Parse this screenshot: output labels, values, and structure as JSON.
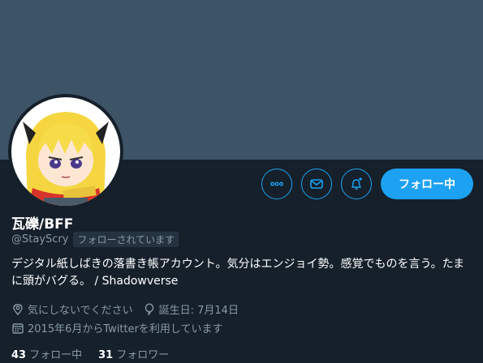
{
  "profile": {
    "display_name": "瓦礫/BFF",
    "handle": "@StayScry",
    "follows_you_badge": "フォローされています",
    "bio": "デジタル紙しばきの落書き帳アカウント。気分はエンジョイ勢。感覚でものを言う。たまに頭がバグる。 / Shadowverse",
    "location": "気にしないでください",
    "birthday": "誕生日: 7月14日",
    "joined": "2015年6月からTwitterを利用しています"
  },
  "actions": {
    "more_icon": "more-dots-icon",
    "message_icon": "envelope-icon",
    "notify_icon": "bell-plus-icon",
    "follow_label": "フォロー中"
  },
  "stats": {
    "following_count": "43",
    "following_label": "フォロー中",
    "followers_count": "31",
    "followers_label": "フォロワー"
  },
  "colors": {
    "background": "#15202b",
    "banner": "#3d5466",
    "accent": "#1da1f2",
    "secondary_text": "#8899a6"
  }
}
